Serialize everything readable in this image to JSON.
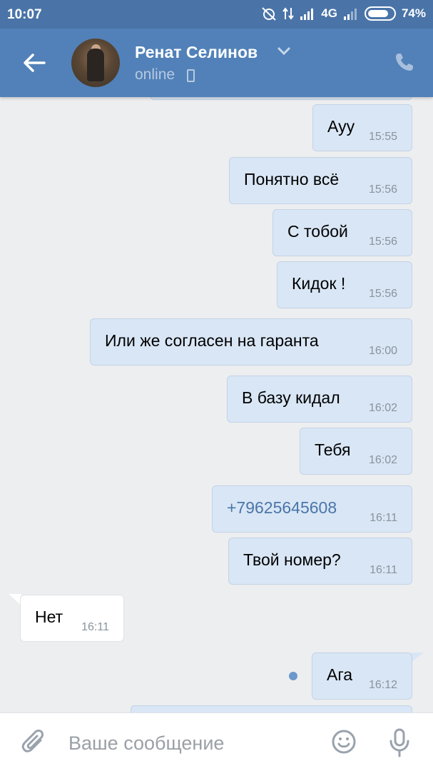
{
  "status_bar": {
    "time": "10:07",
    "network": "4G",
    "battery": "74%"
  },
  "header": {
    "name": "Ренат Селинов",
    "status": "online"
  },
  "messages": [
    {
      "dir": "out",
      "text": "Ауу",
      "time": "15:55"
    },
    {
      "dir": "out",
      "text": "Понятно всё",
      "time": "15:56"
    },
    {
      "dir": "out",
      "text": "С тобой",
      "time": "15:56"
    },
    {
      "dir": "out",
      "text": "Кидок !",
      "time": "15:56"
    },
    {
      "dir": "out",
      "text": "Или же согласен на гаранта",
      "time": "16:00"
    },
    {
      "dir": "out",
      "text": "В базу кидал",
      "time": "16:02"
    },
    {
      "dir": "out",
      "text": "Тебя",
      "time": "16:02"
    },
    {
      "dir": "out",
      "text": "+79625645608",
      "time": "16:11",
      "link": true
    },
    {
      "dir": "out",
      "text": "Твой номер?",
      "time": "16:11"
    },
    {
      "dir": "in",
      "text": "Нет",
      "time": "16:11"
    },
    {
      "dir": "out",
      "text": "Ага",
      "time": "16:12",
      "unread": true
    }
  ],
  "input": {
    "placeholder": "Ваше сообщение"
  },
  "colors": {
    "header_bg": "#5181b8",
    "statusbar_bg": "#4a74a8",
    "chat_bg": "#edeef0",
    "outgoing_bubble": "#d9e6f5",
    "incoming_bubble": "#ffffff",
    "link": "#4a76a8"
  }
}
